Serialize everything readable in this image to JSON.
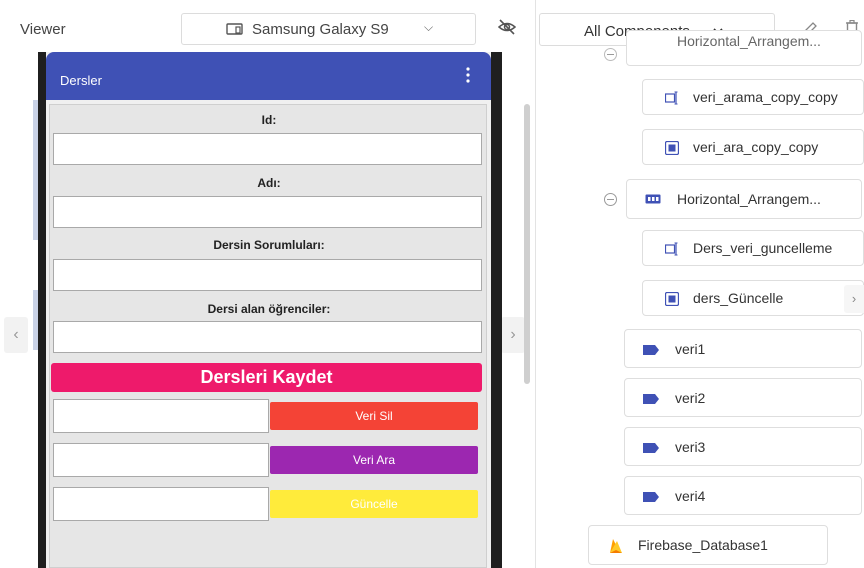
{
  "toolbar": {
    "viewer_label": "Viewer",
    "device_name": "Samsung Galaxy S9",
    "components_label": "All Components"
  },
  "phone": {
    "title": "Dersler",
    "fields": [
      {
        "label": "Id:",
        "value": ""
      },
      {
        "label": "Adı:",
        "value": ""
      },
      {
        "label": "Dersin Sorumluları:",
        "value": ""
      },
      {
        "label": "Dersi alan öğrenciler:",
        "value": ""
      }
    ],
    "save_label": "Dersleri Kaydet",
    "actions": [
      {
        "label": "Veri Sil",
        "color": "#f44336"
      },
      {
        "label": "Veri Ara",
        "color": "#9c27b0"
      },
      {
        "label": "Güncelle",
        "color": "#ffeb3b"
      }
    ]
  },
  "components": {
    "items": [
      {
        "label": "Horizontal_Arrangem...",
        "icon": "horizontal-arrangement-icon"
      },
      {
        "label": "veri_arama_copy_copy",
        "icon": "textbox-icon"
      },
      {
        "label": "veri_ara_copy_copy",
        "icon": "button-icon"
      },
      {
        "label": "Horizontal_Arrangem...",
        "icon": "horizontal-arrangement-icon"
      },
      {
        "label": "Ders_veri_guncelleme",
        "icon": "textbox-icon"
      },
      {
        "label": "ders_Güncelle",
        "icon": "button-icon"
      },
      {
        "label": "veri1",
        "icon": "label-icon"
      },
      {
        "label": "veri2",
        "icon": "label-icon"
      },
      {
        "label": "veri3",
        "icon": "label-icon"
      },
      {
        "label": "veri4",
        "icon": "label-icon"
      },
      {
        "label": "Firebase_Database1",
        "icon": "firebase-icon"
      }
    ]
  }
}
